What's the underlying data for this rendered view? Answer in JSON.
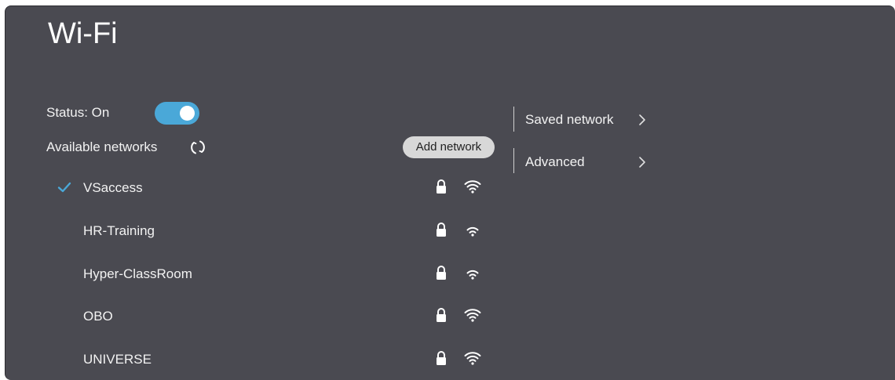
{
  "header": {
    "title": "Wi-Fi"
  },
  "status": {
    "label": "Status: On",
    "toggle_on": true,
    "accent": "#4aa8d8"
  },
  "available": {
    "label": "Available networks",
    "refresh_icon": "refresh-icon"
  },
  "add_network_label": "Add network",
  "networks": [
    {
      "name": "VSaccess",
      "connected": true,
      "secured": true,
      "signal": "full"
    },
    {
      "name": "HR-Training",
      "connected": false,
      "secured": true,
      "signal": "weak"
    },
    {
      "name": "Hyper-ClassRoom",
      "connected": false,
      "secured": true,
      "signal": "weak"
    },
    {
      "name": "OBO",
      "connected": false,
      "secured": true,
      "signal": "full"
    },
    {
      "name": "UNIVERSE",
      "connected": false,
      "secured": true,
      "signal": "full"
    }
  ],
  "side_menu": [
    {
      "label": "Saved network",
      "icon": "chevron-right-icon"
    },
    {
      "label": "Advanced",
      "icon": "chevron-right-icon"
    }
  ],
  "colors": {
    "panel_bg": "#4a4a51",
    "check": "#4aa8d8",
    "button_bg": "#d8d8d8"
  }
}
